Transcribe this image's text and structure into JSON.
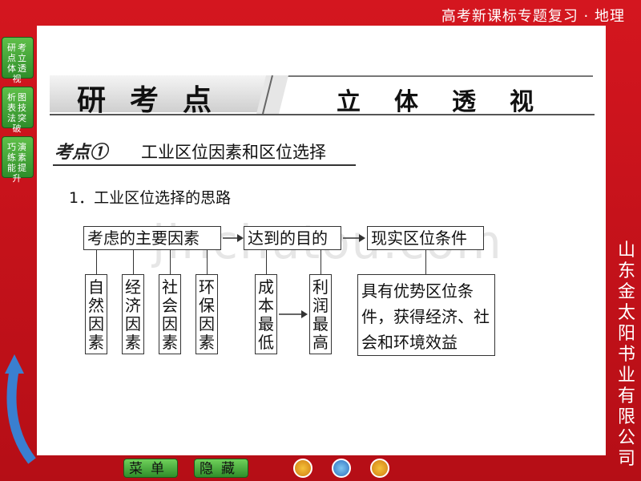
{
  "header": {
    "course_title": "高考新课标专题复习 · 地理"
  },
  "sidebar": {
    "buttons": [
      {
        "label": "研考点立体透视"
      },
      {
        "label": "析图表技法突破"
      },
      {
        "label": "巧演练素能提升"
      }
    ]
  },
  "vertical_publisher": "山东金太阳书业有限公司",
  "section_banner": {
    "left": "研考点",
    "right": "立体透视"
  },
  "topic": {
    "badge": "考点①",
    "title": "工业区位因素和区位选择"
  },
  "subheading": "1．工业区位选择的思路",
  "diagram": {
    "nodes": {
      "main_factors": "考虑的主要因素",
      "goal": "达到的目的",
      "conditions": "现实区位条件",
      "natural": "自然因素",
      "economic": "经济因素",
      "social": "社会因素",
      "environment": "环保因素",
      "low_cost": "成本最低",
      "high_profit": "利润最高",
      "advantage": "具有优势区位条件，获得经济、社会和环境效益"
    }
  },
  "watermark": "jinchutou.com",
  "footer": {
    "menu": "菜单",
    "hide": "隐藏"
  }
}
